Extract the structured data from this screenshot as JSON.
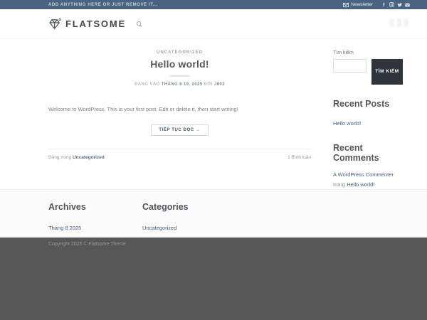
{
  "topbar": {
    "message": "ADD ANYTHING HERE OR JUST REMOVE IT...",
    "newsletter": "Newsletter",
    "social_icons": [
      "facebook",
      "instagram",
      "twitter",
      "email"
    ]
  },
  "header": {
    "logo": "FLATSOME",
    "icons": [
      "search"
    ]
  },
  "post": {
    "category": "UNCATEGORIZED",
    "title": "Hello world!",
    "meta": {
      "posted_on": "ĐĂNG VÀO",
      "date": "THÁNG 8 19, 2025",
      "by": "BỞI",
      "author": "J002"
    },
    "excerpt": "Welcome to WordPress. This is your first post. Edit or delete it, then start writing!",
    "read_more": "TIẾP TỤC ĐỌC →",
    "posted_in": "Đăng trong",
    "category_link": "Uncategorized",
    "comments": "1 Bình luận"
  },
  "sidebar": {
    "search_label": "Tìm kiếm",
    "search_button": "TÌM KIẾM",
    "recent_posts": {
      "title": "Recent Posts",
      "items": [
        "Hello world!"
      ]
    },
    "recent_comments": {
      "title": "Recent Comments",
      "items": [
        {
          "author": "A WordPress Commenter",
          "connector": "trong",
          "post": "Hello world!"
        }
      ]
    }
  },
  "footer": {
    "archives": {
      "title": "Archives",
      "items": [
        "Tháng 8 2025"
      ]
    },
    "categories": {
      "title": "Categories",
      "items": [
        "Uncategorized"
      ]
    },
    "copyright": "Copyright 2025 © Flatsome Theme"
  },
  "colors": {
    "topbar_bg": "#4a6380",
    "primary_link": "#446084",
    "search_button_bg": "#2f343c",
    "dark_footer_bg": "#575757"
  }
}
